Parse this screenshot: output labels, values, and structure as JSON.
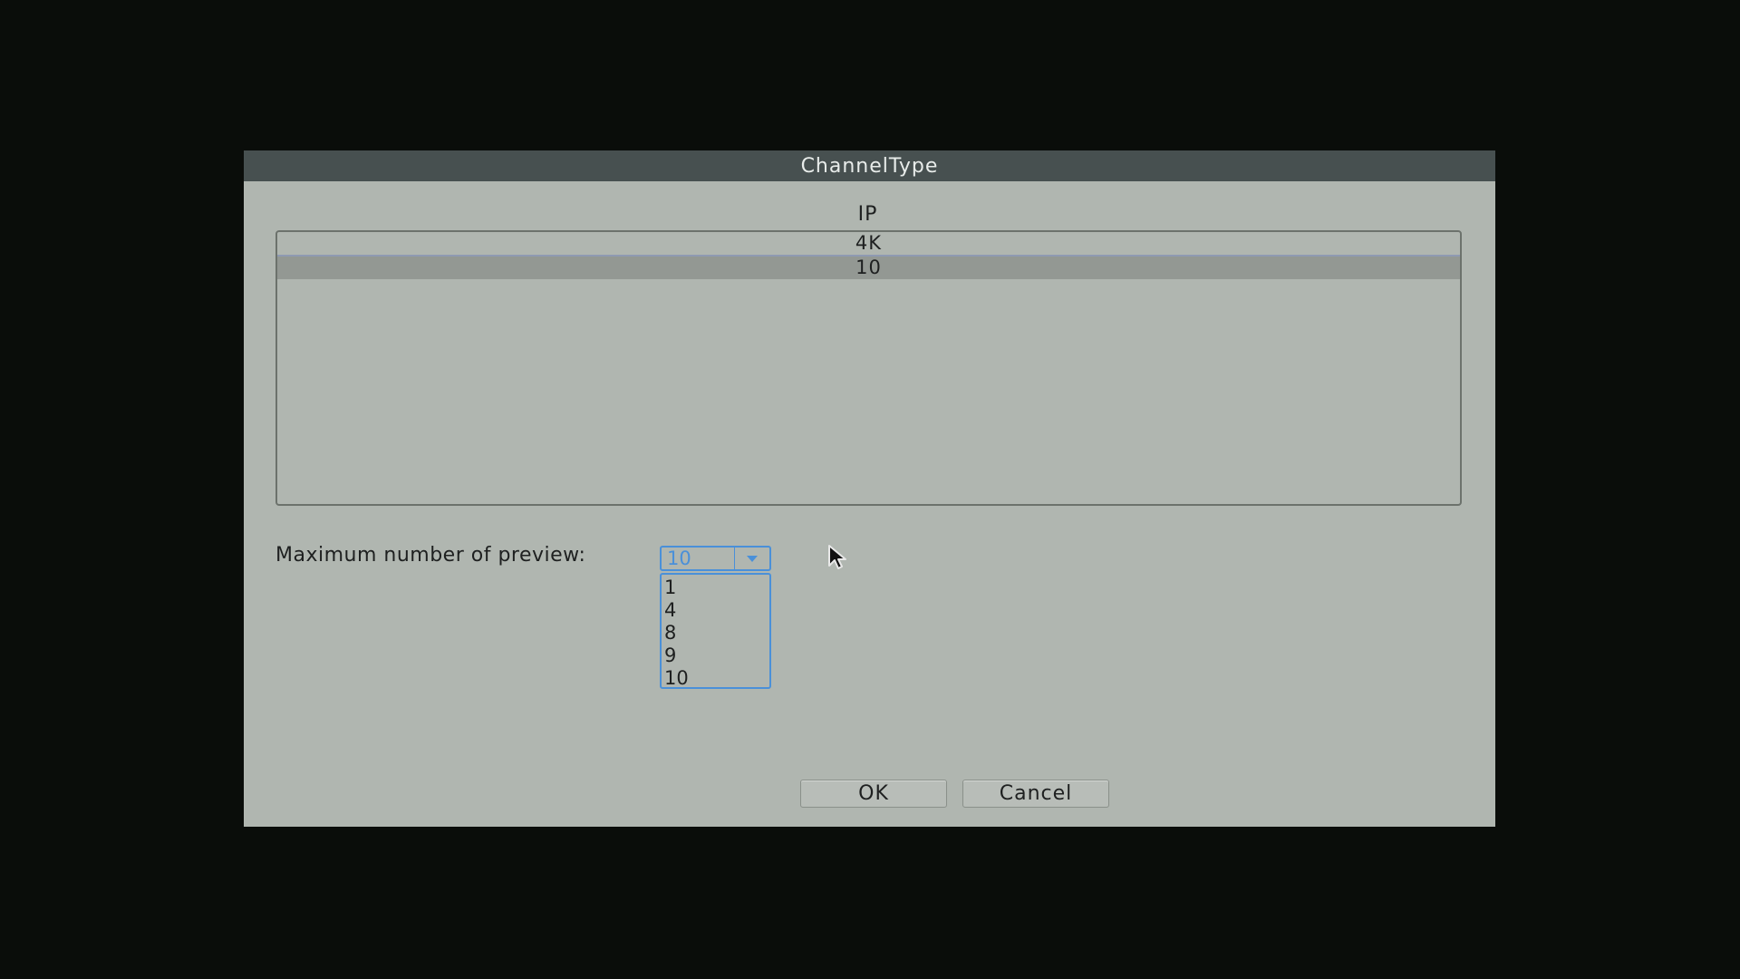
{
  "dialog": {
    "title": "ChannelType",
    "column_header": "IP",
    "rows": [
      {
        "label": "4K"
      },
      {
        "label": "10",
        "selected": true
      }
    ]
  },
  "preview": {
    "label": "Maximum number of preview:",
    "selected_value": "10",
    "options": [
      "1",
      "4",
      "8",
      "9",
      "10"
    ]
  },
  "buttons": {
    "ok": "OK",
    "cancel": "Cancel"
  },
  "colors": {
    "background": "#0a0d0a",
    "dialog": "#b0b6b0",
    "titlebar": "#475050",
    "accent": "#4a90d9"
  },
  "icons": {
    "dropdown_arrow": "chevron-down-icon",
    "cursor": "mouse-pointer-icon"
  }
}
